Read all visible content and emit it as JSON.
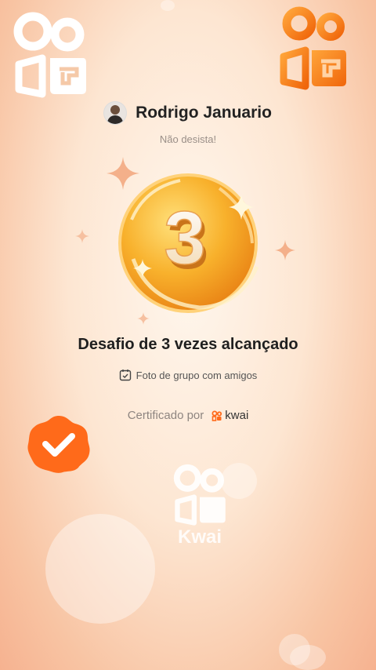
{
  "user": {
    "name": "Rodrigo Januario",
    "tagline": "Não desista!"
  },
  "achievement": {
    "number": "3",
    "title": "Desafio de 3 vezes alcançado",
    "task": "Foto de grupo com amigos"
  },
  "certificate": {
    "label": "Certificado por",
    "brand": "kwai"
  },
  "watermark": {
    "text": "Kwai"
  },
  "colors": {
    "orange": "#ff7a1a",
    "gold": "#f6a722",
    "verified": "#ff6a1a"
  }
}
